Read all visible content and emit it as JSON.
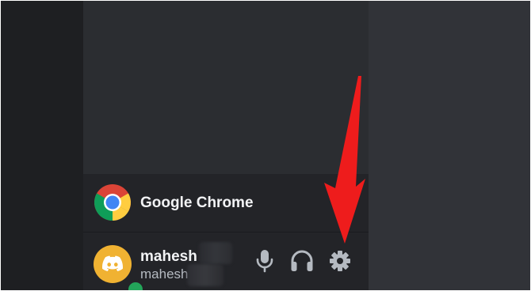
{
  "activity": {
    "app_name": "Google Chrome",
    "icon": "google-chrome-icon"
  },
  "user_panel": {
    "display_name": "mahesh",
    "username": "mahesh",
    "avatar_icon": "discord-logo-icon",
    "status": "online",
    "controls": [
      {
        "name": "mute-microphone",
        "icon": "microphone-icon"
      },
      {
        "name": "deafen",
        "icon": "headphones-icon"
      },
      {
        "name": "user-settings",
        "icon": "gear-icon"
      }
    ]
  },
  "annotation": {
    "arrow_color": "#ee1c1c",
    "points_to": "user-settings"
  },
  "colors": {
    "sidebar_bg": "#2b2d31",
    "panel_bg": "#232428",
    "guild_rail_bg": "#1e1f22",
    "main_bg": "#313338",
    "avatar_bg": "#f0b232",
    "status_online": "#23a55a",
    "icon_color": "#b5bac1"
  }
}
